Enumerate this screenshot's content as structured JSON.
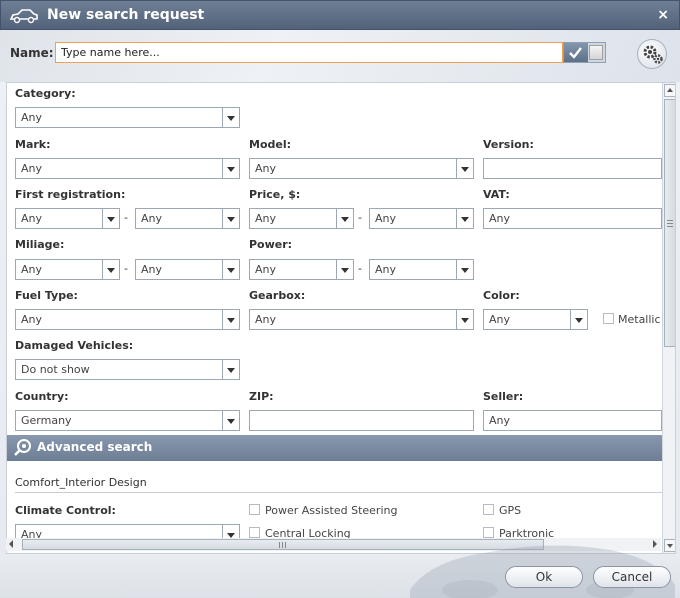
{
  "window": {
    "title": "New search request",
    "close_label": "×"
  },
  "name": {
    "label": "Name:",
    "value": "Type name here..."
  },
  "fields": {
    "category": {
      "label": "Category:",
      "value": "Any"
    },
    "mark": {
      "label": "Mark:",
      "value": "Any"
    },
    "model": {
      "label": "Model:",
      "value": "Any"
    },
    "version": {
      "label": "Version:",
      "value": ""
    },
    "first_registration": {
      "label": "First registration:",
      "from": "Any",
      "to": "Any"
    },
    "price": {
      "label": "Price, $:",
      "from": "Any",
      "to": "Any"
    },
    "vat": {
      "label": "VAT:",
      "value": "Any"
    },
    "miliage": {
      "label": "Miliage:",
      "from": "Any",
      "to": "Any"
    },
    "power": {
      "label": "Power:",
      "from": "Any",
      "to": "Any"
    },
    "fuel_type": {
      "label": "Fuel Type:",
      "value": "Any"
    },
    "gearbox": {
      "label": "Gearbox:",
      "value": "Any"
    },
    "color": {
      "label": "Color:",
      "value": "Any"
    },
    "metallic": {
      "label": "Metallic"
    },
    "damaged": {
      "label": "Damaged Vehicles:",
      "value": "Do not show"
    },
    "country": {
      "label": "Country:",
      "value": "Germany"
    },
    "zip": {
      "label": "ZIP:",
      "value": ""
    },
    "seller": {
      "label": "Seller:",
      "value": "Any"
    }
  },
  "range_separator": "-",
  "advanced": {
    "title": "Advanced search",
    "section": "Comfort_Interior Design",
    "climate_label": "Climate Control:",
    "climate_value": "Any",
    "options": [
      "Power Assisted Steering",
      "GPS",
      "Central Locking",
      "Parktronic"
    ]
  },
  "buttons": {
    "ok": "Ok",
    "cancel": "Cancel"
  },
  "colors": {
    "title_bar": "#5e6d84",
    "accent_border": "#f0a050",
    "advanced_bar": "#7a8ba1"
  }
}
